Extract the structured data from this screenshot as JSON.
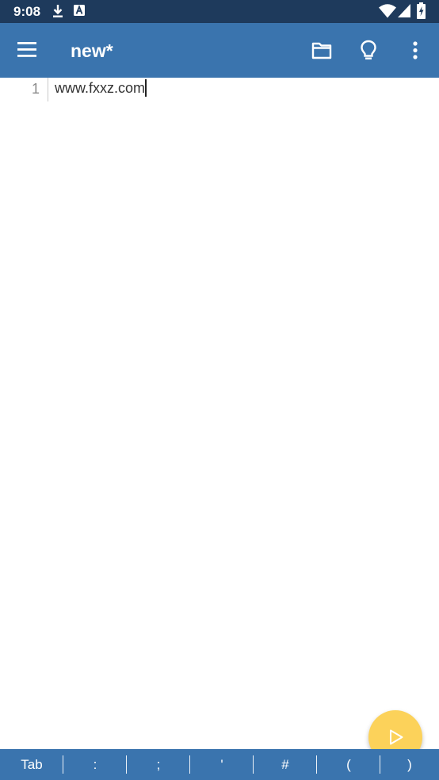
{
  "status_bar": {
    "time": "9:08",
    "left_icons": [
      "download-icon",
      "a-notification-icon"
    ],
    "right_icons": [
      "wifi-icon",
      "signal-icon",
      "battery-charging-icon"
    ],
    "background": "#1e3a5c"
  },
  "app_bar": {
    "title": "new*",
    "background": "#3a74ae",
    "actions": [
      "folder-icon",
      "lightbulb-icon",
      "more-vert-icon"
    ]
  },
  "editor": {
    "lines": [
      {
        "number": "1",
        "text": "www.fxxz.com"
      }
    ]
  },
  "fab": {
    "icon": "play-icon",
    "color": "#fcd25a"
  },
  "symbol_bar": {
    "keys": [
      "Tab",
      ":",
      ";",
      "'",
      "#",
      "(",
      ")"
    ]
  }
}
